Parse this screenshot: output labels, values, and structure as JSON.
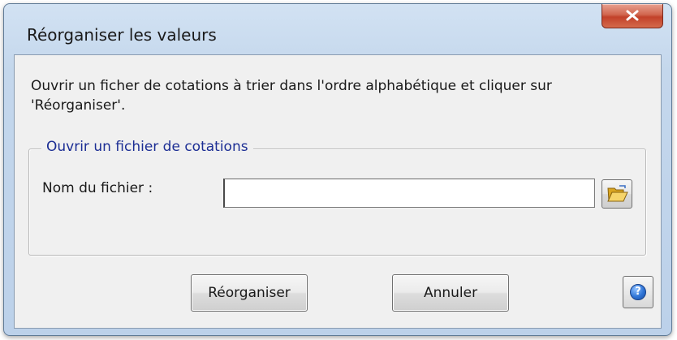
{
  "window": {
    "title": "Réorganiser les valeurs"
  },
  "content": {
    "instructions": "Ouvrir un ficher de cotations à trier dans l'ordre alphabétique et cliquer sur 'Réorganiser'."
  },
  "group": {
    "legend": "Ouvrir un fichier de cotations",
    "file_label": "Nom du fichier :",
    "file_value": "",
    "file_placeholder": ""
  },
  "buttons": {
    "reorganize": "Réorganiser",
    "cancel": "Annuler",
    "help_glyph": "?"
  },
  "icons": {
    "close": "close-icon",
    "browse": "open-folder-icon",
    "help": "help-icon"
  },
  "colors": {
    "close_button": "#c9533c",
    "group_legend": "#1c2e94",
    "help_icon": "#2f74d6",
    "window_frame": "#c4d7ec"
  }
}
